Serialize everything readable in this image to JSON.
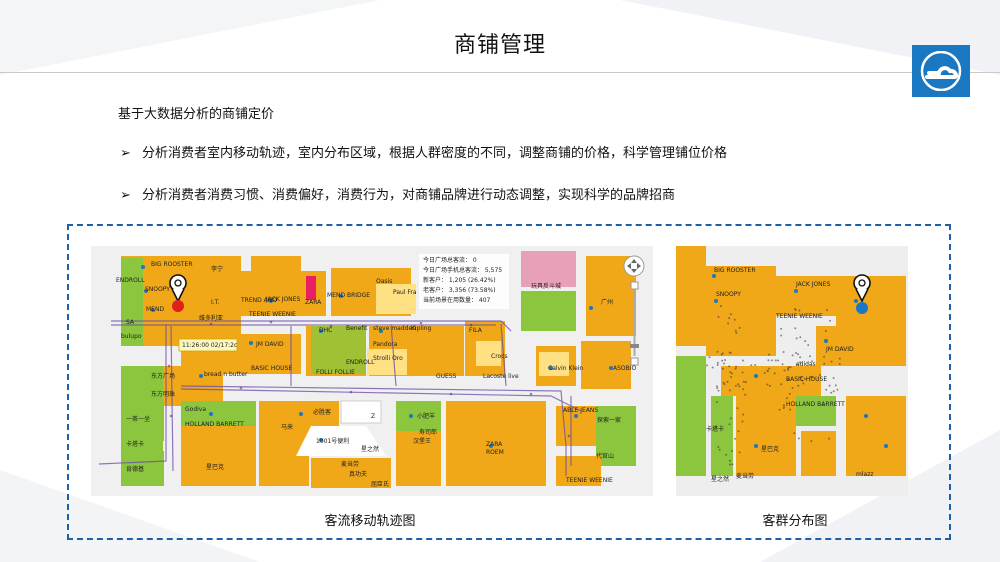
{
  "page": {
    "title": "商铺管理",
    "subtitle": "基于大数据分析的商铺定价",
    "bullets": [
      {
        "marker": "➢",
        "text": "分析消费者室内移动轨迹，室内分布区域，根据人群密度的不同，调整商铺的价格，科学管理铺位价格"
      },
      {
        "marker": "➢",
        "text": "分析消费者消费习惯、消费偏好，消费行为，对商铺品牌进行动态调整，实现科学的品牌招商"
      }
    ]
  },
  "colors": {
    "accent": "#1e5fa6",
    "shop_orange": "#f0a818",
    "shop_green": "#8cc63f",
    "logo_blue": "#1a78c2",
    "track_purple": "#6a4ca8"
  },
  "map_left": {
    "caption": "客流移动轨迹图",
    "stats": [
      "今日广场总客流： 0",
      "今日广场手机总客流： 5,575",
      "新客户： 1,205 (26.42%)",
      "老客户： 3,356 (73.58%)",
      "当前场景在用数量： 407"
    ],
    "timestamp": "11:26:00 02/17:2c",
    "shop_labels": [
      "BIG ROOSTER",
      "李宁",
      "SNOOPY",
      "TREND ANO",
      "Oasis",
      "MEND BRIDGE",
      "JACK JONES",
      "Paul Fra",
      "MEND",
      "TEENIE WEENIE",
      "ZARA",
      "I.T.",
      "维多利亚",
      "DHC",
      "Benefit",
      "steve madden",
      "Kipling",
      "FILA",
      "Pandora",
      "Strolli Oro",
      "ENDROLL",
      "BASIC HOUSE",
      "FOLLI FOLLIE",
      "GUESS",
      "Lacoste live",
      "Crocs",
      "Calvin Klein",
      "ASOBIO",
      "JM DAVID",
      "bread n butter",
      "Godiva",
      "HOLLAND BARRETT",
      "马来",
      "必胜客",
      "1001号便利",
      "汉堡王",
      "Z",
      "ZARA",
      "ROEM",
      "ABLE JEANS",
      "TEENIE WEENIE",
      "星巴克",
      "真功夫",
      "屈臣氏",
      "广州",
      "玩具反斗城",
      "探索一家",
      "ENDROLL",
      "SA",
      "bulupo",
      "东方广场",
      "东方明珠",
      "一茶一坐",
      "肯德基",
      "卡塔卡",
      "麦当劳",
      "代官山",
      "星之然",
      "小肥羊",
      "寿司郎"
    ]
  },
  "map_right": {
    "caption": "客群分布图",
    "shop_labels": [
      "BIG ROOSTER",
      "SNOOPY",
      "TEENIE WEENIE",
      "JACK JONES",
      "BASIC HOUSE",
      "HOLLAND BARRETT",
      "adidas",
      "星巴克",
      "麦当劳",
      "JM DAVID",
      "卡塔卡",
      "星之然",
      "mlazz"
    ]
  },
  "icons": {
    "logo": "cloud-logo-icon",
    "pin": "location-pin-icon",
    "zoom": "map-zoom-control-icon"
  }
}
